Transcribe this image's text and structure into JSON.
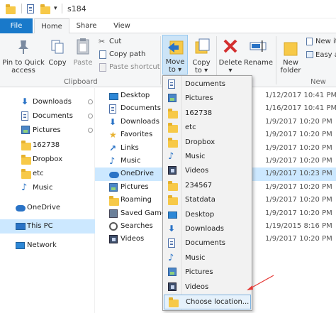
{
  "title": "s184",
  "tabs": {
    "file": "File",
    "home": "Home",
    "share": "Share",
    "view": "View"
  },
  "ribbon": {
    "pin_line1": "Pin to Quick",
    "pin_line2": "access",
    "copy": "Copy",
    "paste": "Paste",
    "cut": "Cut",
    "copy_path": "Copy path",
    "paste_shortcut": "Paste shortcut",
    "clipboard_group": "Clipboard",
    "move_to_line1": "Move",
    "move_to_line2": "to ▾",
    "copy_to_line1": "Copy",
    "copy_to_line2": "to ▾",
    "delete_line1": "Delete",
    "delete_line2": "▾",
    "rename": "Rename",
    "new_folder_line1": "New",
    "new_folder_line2": "folder",
    "new_item": "New it",
    "easy_access": "Easy ac",
    "new_group": "New",
    "accent": "#1979ca",
    "delete_color": "#d32f2f"
  },
  "nav": {
    "items": [
      {
        "label": "Downloads",
        "icon": "download-icon",
        "pinned": true
      },
      {
        "label": "Documents",
        "icon": "documents-icon",
        "pinned": true
      },
      {
        "label": "Pictures",
        "icon": "pictures-icon",
        "pinned": true
      },
      {
        "label": "162738",
        "icon": "folder-icon",
        "pinned": false
      },
      {
        "label": "Dropbox",
        "icon": "folder-icon",
        "pinned": false
      },
      {
        "label": "etc",
        "icon": "folder-icon",
        "pinned": false
      },
      {
        "label": "Music",
        "icon": "music-icon",
        "pinned": false
      },
      {
        "label": "OneDrive",
        "icon": "cloud-icon",
        "pinned": false
      },
      {
        "label": "This PC",
        "icon": "computer-icon",
        "pinned": false,
        "selected": true
      },
      {
        "label": "Network",
        "icon": "network-icon",
        "pinned": false
      }
    ]
  },
  "files": {
    "rows": [
      {
        "name": "Desktop",
        "icon": "desktop-icon",
        "date": "1/12/2017 10:41 PM"
      },
      {
        "name": "Documents",
        "icon": "documents-icon",
        "date": "1/16/2017 10:41 PM"
      },
      {
        "name": "Downloads",
        "icon": "download-icon",
        "date": "1/9/2017 10:20 PM"
      },
      {
        "name": "Favorites",
        "icon": "star-icon",
        "date": "1/9/2017 10:20 PM"
      },
      {
        "name": "Links",
        "icon": "link-icon",
        "date": "1/9/2017 10:20 PM"
      },
      {
        "name": "Music",
        "icon": "music-icon",
        "date": "1/9/2017 10:20 PM"
      },
      {
        "name": "OneDrive",
        "icon": "cloud-icon",
        "date": "1/9/2017 10:23 PM",
        "selected": true
      },
      {
        "name": "Pictures",
        "icon": "pictures-icon",
        "date": "1/9/2017 10:20 PM"
      },
      {
        "name": "Roaming",
        "icon": "folder-icon",
        "date": "1/9/2017 10:20 PM"
      },
      {
        "name": "Saved Games",
        "icon": "saved-games-icon",
        "date": "1/9/2017 10:20 PM"
      },
      {
        "name": "Searches",
        "icon": "search-icon",
        "date": "1/19/2015 8:16 PM"
      },
      {
        "name": "Videos",
        "icon": "videos-icon",
        "date": "1/9/2017 10:20 PM"
      }
    ]
  },
  "dropdown": {
    "items": [
      {
        "label": "Documents",
        "icon": "documents-icon"
      },
      {
        "label": "Pictures",
        "icon": "pictures-icon"
      },
      {
        "label": "162738",
        "icon": "folder-icon"
      },
      {
        "label": "etc",
        "icon": "folder-icon"
      },
      {
        "label": "Dropbox",
        "icon": "folder-icon"
      },
      {
        "label": "Music",
        "icon": "music-icon"
      },
      {
        "label": "Videos",
        "icon": "videos-icon"
      },
      {
        "label": "234567",
        "icon": "folder-icon"
      },
      {
        "label": "Statdata",
        "icon": "folder-icon"
      },
      {
        "label": "Desktop",
        "icon": "desktop-icon"
      },
      {
        "label": "Downloads",
        "icon": "download-icon"
      },
      {
        "label": "Documents",
        "icon": "documents-icon"
      },
      {
        "label": "Music",
        "icon": "music-icon"
      },
      {
        "label": "Pictures",
        "icon": "pictures-icon"
      },
      {
        "label": "Videos",
        "icon": "videos-icon"
      }
    ],
    "choose_location": "Choose location..."
  }
}
